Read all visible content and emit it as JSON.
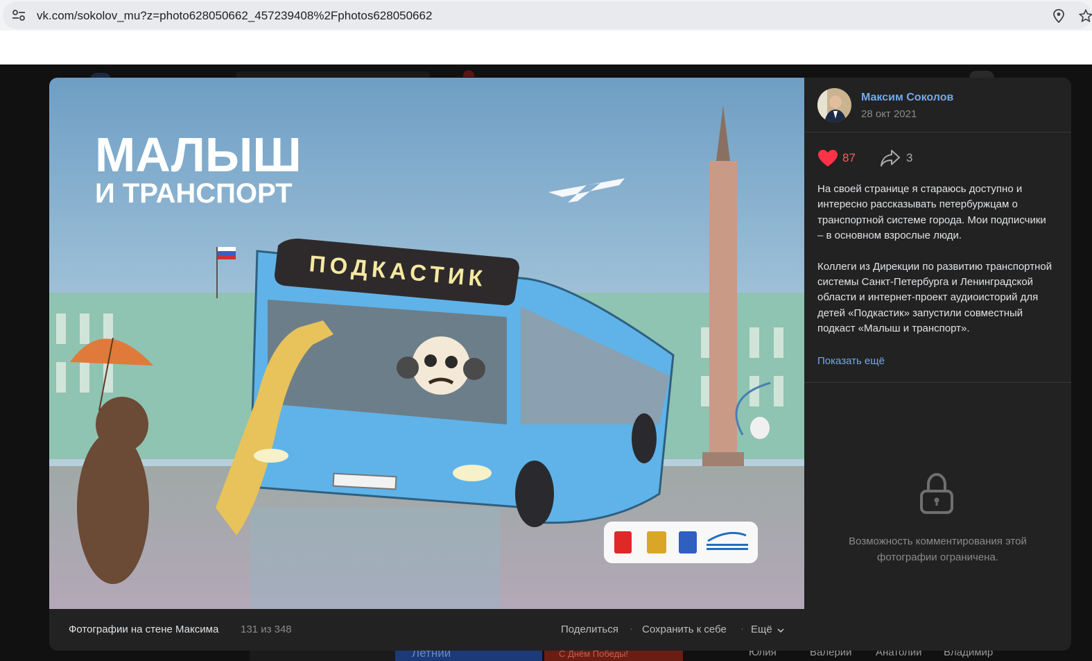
{
  "browser": {
    "url": "vk.com/sokolov_mu?z=photo628050662_457239408%2Fphotos628050662",
    "icons": [
      "site-info-icon",
      "location-icon",
      "bookmark-star-icon"
    ]
  },
  "background_page": {
    "tiles": [
      "Летний",
      "С Днём Победы!",
      "Юлия",
      "Валерий",
      "Анатолий",
      "Владимир"
    ]
  },
  "photo": {
    "title_line1": "МАЛЫШ",
    "title_line2": "И ТРАНСПОРТ",
    "bus_sign": "ПОДКАСТИК",
    "logos": [
      "spb-coat-of-arms",
      "russia-coat-of-arms",
      "leningrad-oblast-coat-of-arms",
      "transport-directorate-logo"
    ]
  },
  "post": {
    "author_name": "Максим Соколов",
    "date": "28 окт 2021",
    "likes": "87",
    "shares": "3",
    "paragraph1": "На своей странице я стараюсь доступно и интересно рассказывать петербуржцам о транспортной системе города. Мои подписчики – в основном взрослые люди.",
    "paragraph2": "Коллеги из Дирекции по развитию транспортной системы Санкт-Петербурга и Ленинградской области и интернет-проект аудиоисторий для детей «Подкастик» запустили совместный подкаст «Малыш и транспорт».",
    "show_more": "Показать ещё",
    "comments_closed": "Возможность комментирования этой фотографии ограничена."
  },
  "footer": {
    "album_title": "Фотографии на стене Максима",
    "counter": "131 из 348",
    "share": "Поделиться",
    "separator": "·",
    "save": "Сохранить к себе",
    "more": "Ещё"
  },
  "colors": {
    "accent_link": "#71aaeb",
    "like_red": "#ff5c5c",
    "modal_bg": "#222222",
    "bus_blue": "#5fb3e8"
  }
}
